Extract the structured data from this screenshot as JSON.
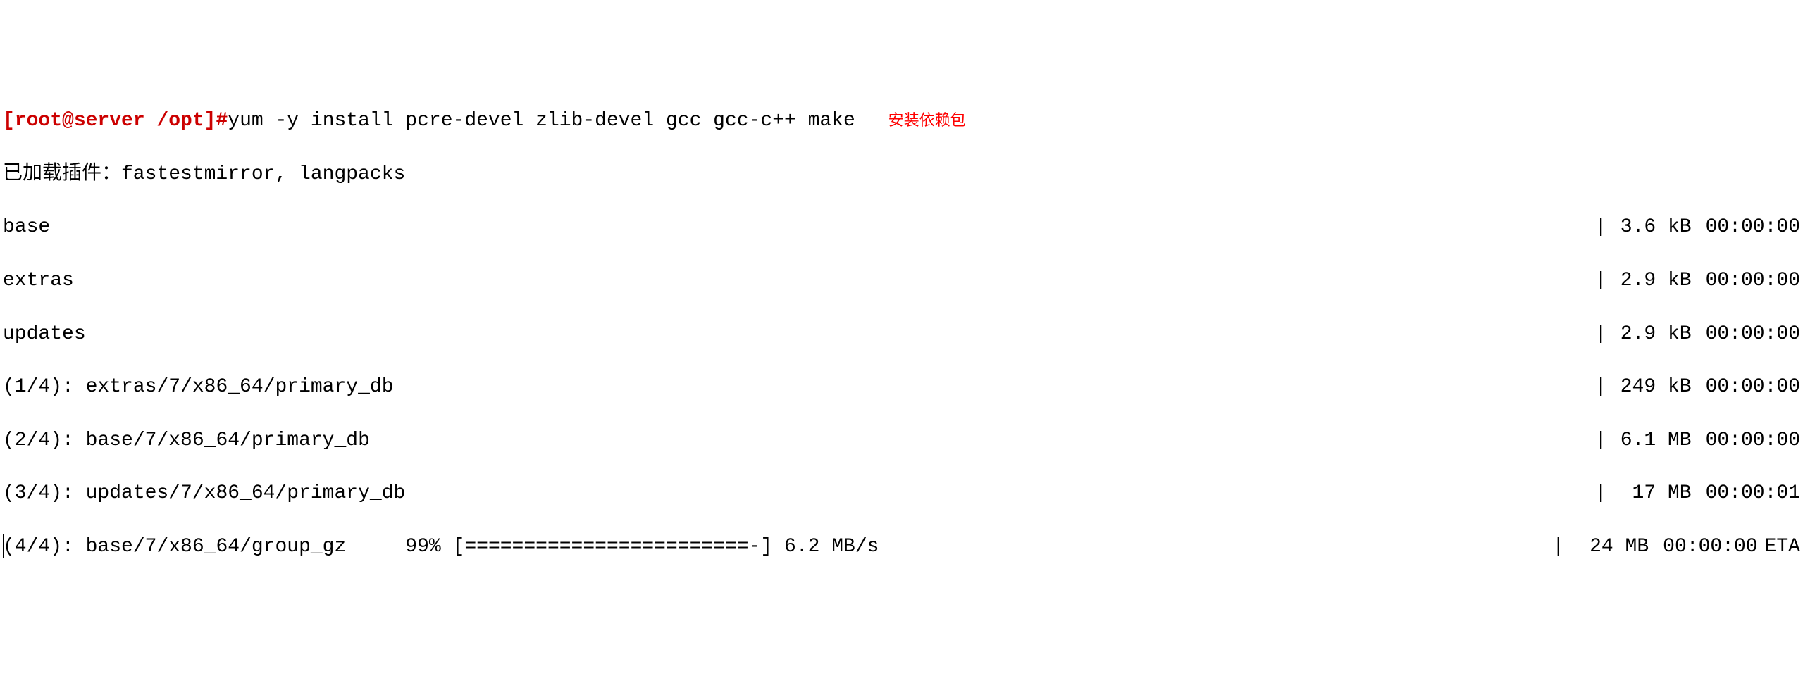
{
  "prompt": {
    "full": "[root@server /opt]#",
    "user_host": "root@server",
    "cwd": "/opt"
  },
  "command": "yum -y install pcre-devel zlib-devel gcc gcc-c++ make ",
  "annotation": "安装依赖包",
  "plugins_line": "已加载插件：fastestmirror, langpacks",
  "repos": [
    {
      "name": "base",
      "size": "3.6 kB",
      "time": "00:00:00",
      "eta": ""
    },
    {
      "name": "extras",
      "size": "2.9 kB",
      "time": "00:00:00",
      "eta": ""
    },
    {
      "name": "updates",
      "size": "2.9 kB",
      "time": "00:00:00",
      "eta": ""
    },
    {
      "name": "(1/4): extras/7/x86_64/primary_db",
      "size": "249 kB",
      "time": "00:00:00",
      "eta": ""
    },
    {
      "name": "(2/4): base/7/x86_64/primary_db",
      "size": "6.1 MB",
      "time": "00:00:00",
      "eta": ""
    },
    {
      "name": "(3/4): updates/7/x86_64/primary_db",
      "size": " 17 MB",
      "time": "00:00:01",
      "eta": ""
    }
  ],
  "progress": {
    "name": "(4/4): base/7/x86_64/group_gz",
    "percent": "99%",
    "bar": "[========================-]",
    "speed": "6.2 MB/s",
    "size": " 24 MB",
    "time": "00:00:00",
    "eta": "ETA"
  },
  "pipe": "|"
}
